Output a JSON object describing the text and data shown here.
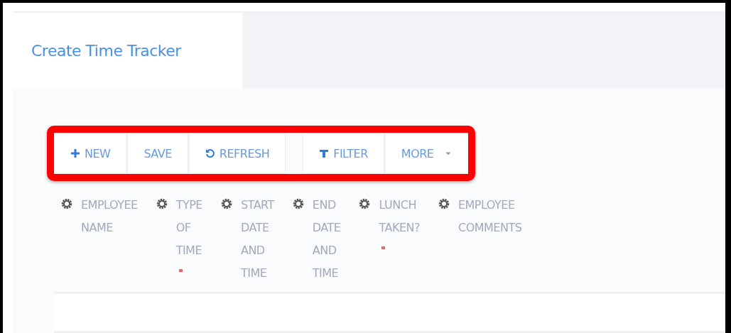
{
  "tabs": [
    {
      "label": "Create Time Tracker",
      "selected": true
    }
  ],
  "toolbar": {
    "highlighted": true,
    "groups": [
      [
        {
          "kind": "new",
          "label": "NEW"
        },
        {
          "kind": "save",
          "label": "SAVE"
        },
        {
          "kind": "refresh",
          "label": "REFRESH"
        }
      ],
      [
        {
          "kind": "filter",
          "label": "FILTER"
        },
        {
          "kind": "more",
          "label": "MORE"
        }
      ]
    ]
  },
  "table": {
    "columns": [
      {
        "label": "EMPLOYEE NAME",
        "required": false
      },
      {
        "label": "TYPE OF TIME",
        "required": true
      },
      {
        "label": "START DATE AND TIME",
        "required": false
      },
      {
        "label": "END DATE AND TIME",
        "required": false
      },
      {
        "label": "LUNCH TAKEN?",
        "required": true
      },
      {
        "label": "EMPLOYEE COMMENTS",
        "required": false
      }
    ]
  }
}
